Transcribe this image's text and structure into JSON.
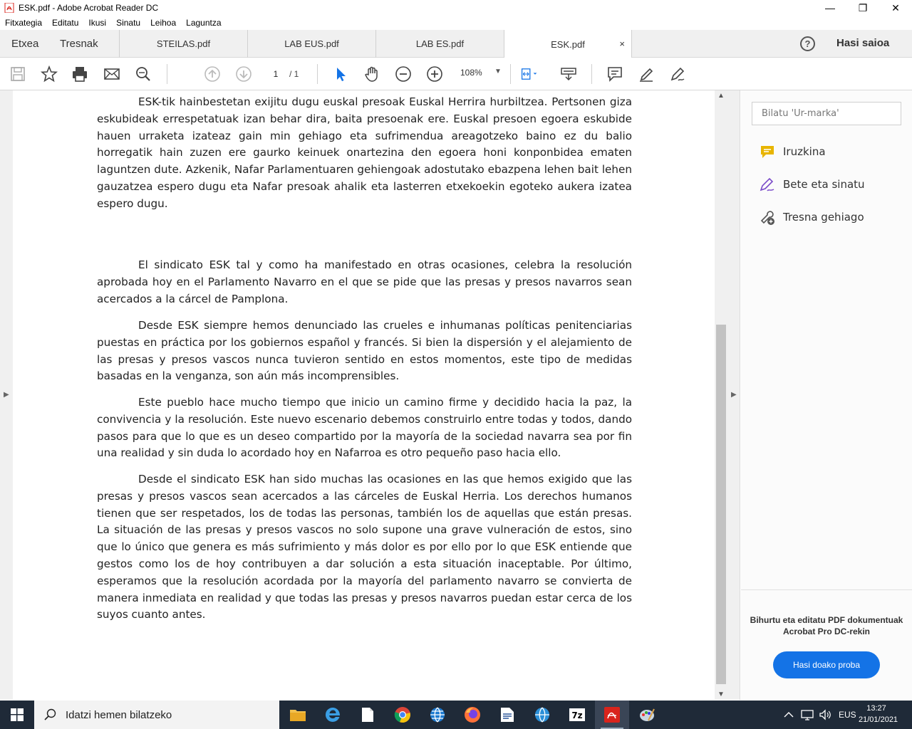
{
  "window": {
    "title": "ESK.pdf - Adobe Acrobat Reader DC",
    "minimize": "—",
    "maximize": "❐",
    "close": "✕"
  },
  "menu": [
    "Fitxategia",
    "Editatu",
    "Ikusi",
    "Sinatu",
    "Leihoa",
    "Laguntza"
  ],
  "nav_tabs": {
    "home": "Etxea",
    "tools": "Tresnak"
  },
  "doc_tabs": [
    "STEILAS.pdf",
    "LAB EUS.pdf",
    "LAB ES.pdf",
    "ESK.pdf"
  ],
  "active_tab_close": "×",
  "help": "?",
  "signin": "Hasi saioa",
  "toolbar": {
    "page_current": "1",
    "page_total": "/  1",
    "zoom": "108%"
  },
  "document": {
    "paragraphs": [
      "ESK-tik hainbestetan exijitu dugu euskal presoak Euskal Herrira hurbiltzea. Pertsonen giza eskubideak errespetatuak izan behar dira, baita presoenak ere. Euskal presoen egoera eskubide hauen urraketa izateaz gain min gehiago eta sufrimendua areagotzeko baino ez du balio horregatik hain zuzen ere gaurko keinuek onartezina den egoera honi konponbidea ematen laguntzen dute. Azkenik, Nafar Parlamentuaren gehiengoak adostutako ebazpena lehen bait lehen gauzatzea espero dugu eta Nafar presoak ahalik eta lasterren etxekoekin egoteko aukera izatea espero dugu.",
      "El sindicato ESK tal y como ha manifestado en otras ocasiones, celebra la resolución aprobada hoy en el Parlamento Navarro en el que se pide que las presas y presos navarros sean acercados a la cárcel de Pamplona.",
      "Desde ESK siempre hemos denunciado las crueles e inhumanas políticas penitenciarias puestas en práctica por los gobiernos español y francés. Si bien la dispersión y el alejamiento de las presas y presos vascos nunca tuvieron sentido en estos momentos, este tipo de medidas basadas en la venganza, son aún más incomprensibles.",
      "Este pueblo hace mucho tiempo que inicio un camino firme y decidido hacia la paz, la convivencia y la resolución. Este nuevo escenario debemos construirlo entre todas y todos, dando pasos para que lo que es un deseo compartido por la mayoría de la sociedad navarra sea por fin una realidad y sin duda lo acordado hoy en Nafarroa es otro pequeño paso hacia ello.",
      "Desde el sindicato ESK han sido muchas las ocasiones en las que hemos exigido que las presas y presos vascos sean acercados a las cárceles de Euskal Herria. Los derechos humanos tienen que ser respetados, los de todas las personas, también los de aquellas que están presas. La situación de las presas y presos vascos no solo supone una grave vulneración de estos, sino que lo único que genera es más sufrimiento y más dolor es por ello por lo que ESK entiende que gestos como los de hoy contribuyen a dar solución a esta situación inaceptable. Por último, esperamos que la resolución acordada por la mayoría del parlamento navarro se convierta de manera inmediata en realidad y que todas las presas y presos navarros puedan estar cerca de los suyos cuanto antes."
    ]
  },
  "right_pane": {
    "search_placeholder": "Bilatu 'Ur-marka'",
    "tools": [
      "Iruzkina",
      "Bete eta sinatu",
      "Tresna gehiago"
    ],
    "promo_line1": "Bihurtu eta editatu PDF dokumentuak",
    "promo_line2": "Acrobat Pro DC-rekin",
    "promo_button": "Hasi doako proba"
  },
  "taskbar": {
    "search_placeholder": "Idatzi hemen bilatzeko",
    "language": "EUS",
    "time": "13:27",
    "date": "21/01/2021"
  },
  "colors": {
    "accent": "#1473e6",
    "acrobat_red": "#d9241c",
    "comment_yellow": "#e8b500",
    "sign_purple": "#7a4bc9"
  }
}
